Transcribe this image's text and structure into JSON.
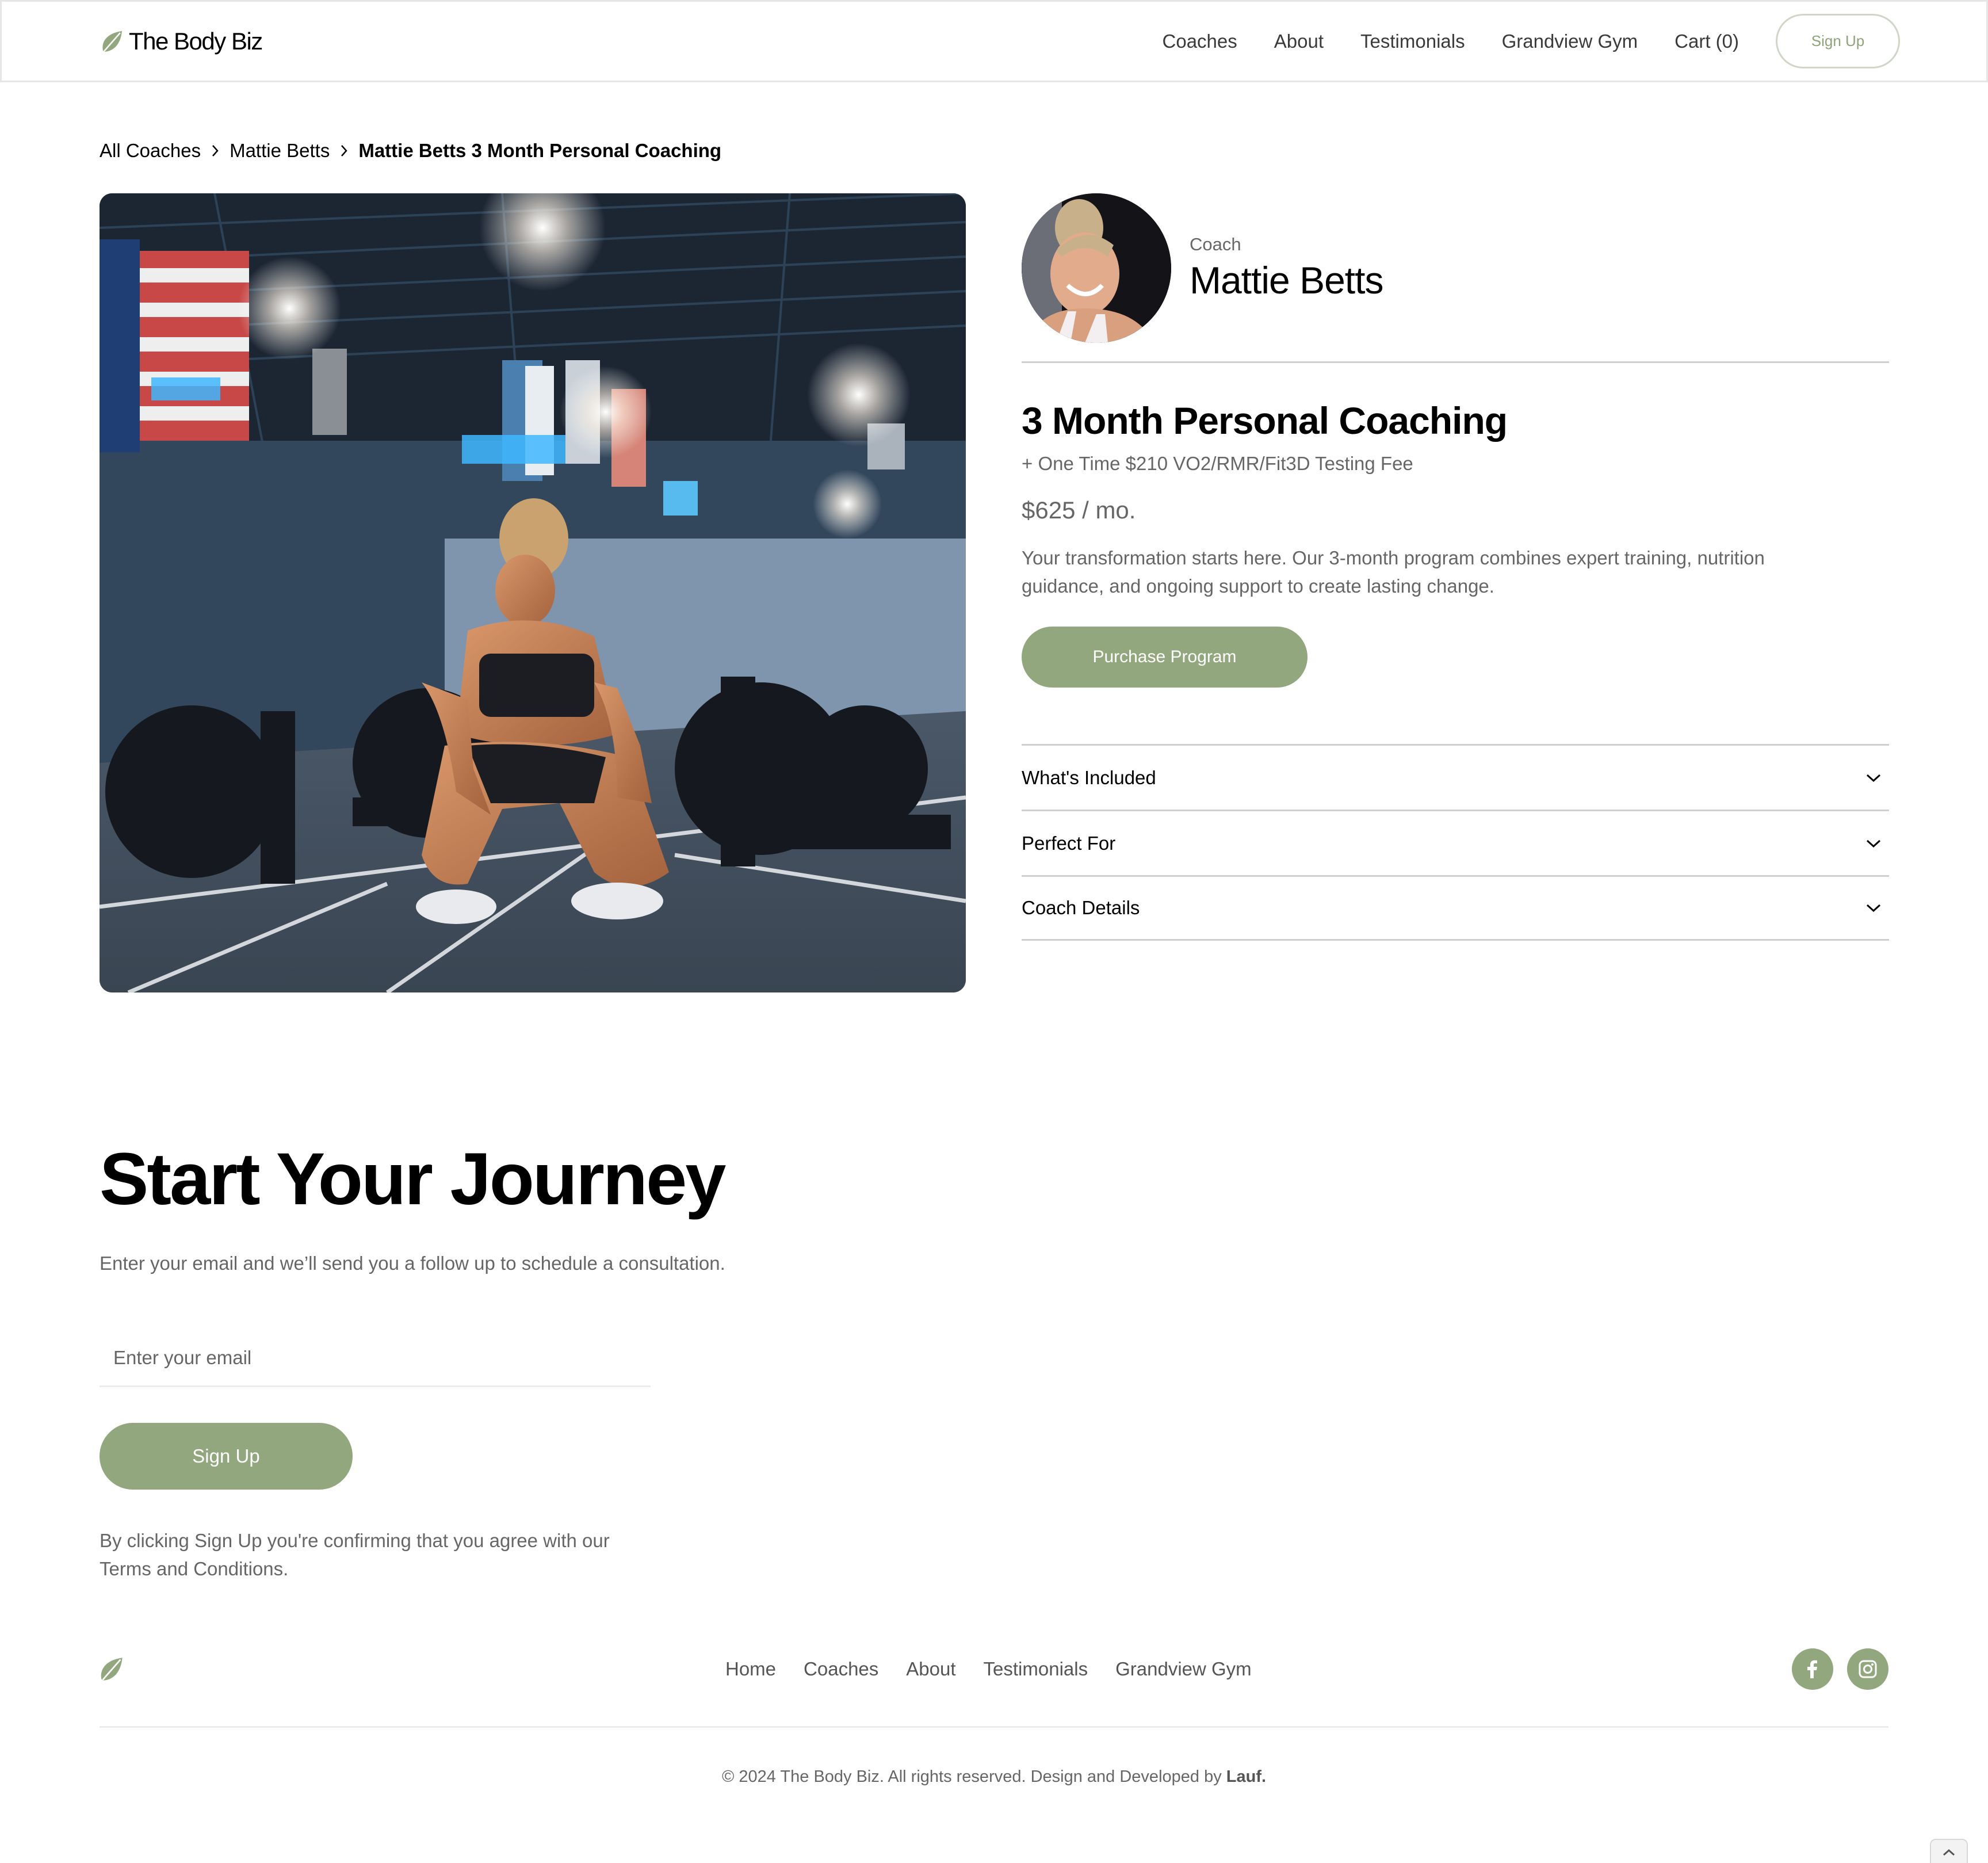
{
  "nav": {
    "brand": "The Body Biz",
    "links": [
      "Coaches",
      "About",
      "Testimonials",
      "Grandview Gym",
      "Cart (0)"
    ],
    "signup_label": "Sign Up"
  },
  "breadcrumb": {
    "items": [
      "All Coaches",
      "Mattie Betts"
    ],
    "current": "Mattie Betts 3 Month Personal Coaching"
  },
  "coach": {
    "label": "Coach",
    "name": "Mattie Betts"
  },
  "program": {
    "title": "3 Month Personal Coaching",
    "fee_note": "+ One Time $210 VO2/RMR/Fit3D Testing Fee",
    "price": "$625 / mo.",
    "description": "Your transformation starts here. Our 3-month program combines expert training, nutrition guidance, and ongoing support to create lasting change.",
    "purchase_label": "Purchase Program",
    "accordion": [
      "What's Included",
      "Perfect For",
      "Coach Details"
    ]
  },
  "journey": {
    "title": "Start Your Journey",
    "subtitle": "Enter your email and we’ll send you a follow up to schedule a consultation.",
    "email_placeholder": "Enter your email",
    "email_value": "",
    "signup_label": "Sign Up",
    "terms": "By clicking Sign Up you're confirming that you agree with our Terms and Conditions."
  },
  "footer": {
    "links": [
      "Home",
      "Coaches",
      "About",
      "Testimonials",
      "Grandview Gym"
    ],
    "socials": [
      "facebook-icon",
      "instagram-icon"
    ],
    "copyright_prefix": "© 2024 The Body Biz. All rights reserved. Design and Developed by ",
    "copyright_brand": "Lauf."
  },
  "colors": {
    "accent": "#93a77e",
    "accent_border": "#cfd6c7",
    "text_muted": "#666666",
    "divider": "#cfcfcf"
  }
}
